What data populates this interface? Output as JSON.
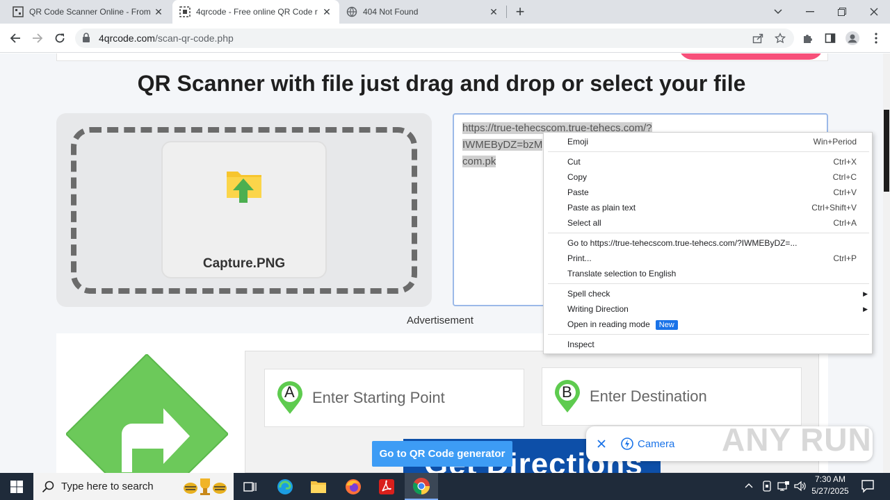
{
  "browser": {
    "tabs": [
      {
        "title": "QR Code Scanner Online - From"
      },
      {
        "title": "4qrcode - Free online QR Code r"
      },
      {
        "title": "404 Not Found"
      }
    ],
    "url_domain": "4qrcode.com",
    "url_path": "/scan-qr-code.php"
  },
  "page": {
    "heading": "QR Scanner with file just drag and drop or select your file",
    "file_name": "Capture.PNG",
    "result_lines": [
      "https://true-tehecscom.true-tehecs.com/?",
      "IWMEByDZ=bzM",
      "com.pk"
    ],
    "ad_label": "Advertisement",
    "start_placeholder": "Enter Starting Point",
    "dest_placeholder": "Enter Destination",
    "marker_a": "A",
    "marker_b": "B",
    "cta": "Go to QR Code generator",
    "banner_text": "Get Directions",
    "camera_label": "Camera",
    "watermark": "ANY RUN"
  },
  "context_menu": {
    "emoji": {
      "label": "Emoji",
      "shortcut": "Win+Period"
    },
    "cut": {
      "label": "Cut",
      "shortcut": "Ctrl+X"
    },
    "copy": {
      "label": "Copy",
      "shortcut": "Ctrl+C"
    },
    "paste": {
      "label": "Paste",
      "shortcut": "Ctrl+V"
    },
    "paste_plain": {
      "label": "Paste as plain text",
      "shortcut": "Ctrl+Shift+V"
    },
    "select_all": {
      "label": "Select all",
      "shortcut": "Ctrl+A"
    },
    "goto": {
      "label": "Go to https://true-tehecscom.true-tehecs.com/?IWMEByDZ=..."
    },
    "print": {
      "label": "Print...",
      "shortcut": "Ctrl+P"
    },
    "translate": {
      "label": "Translate selection to English"
    },
    "spell": {
      "label": "Spell check"
    },
    "writing": {
      "label": "Writing Direction"
    },
    "reading": {
      "label": "Open in reading mode",
      "badge": "New"
    },
    "inspect": {
      "label": "Inspect"
    }
  },
  "taskbar": {
    "search_placeholder": "Type here to search",
    "time": "7:30 AM",
    "date": "5/27/2025"
  }
}
